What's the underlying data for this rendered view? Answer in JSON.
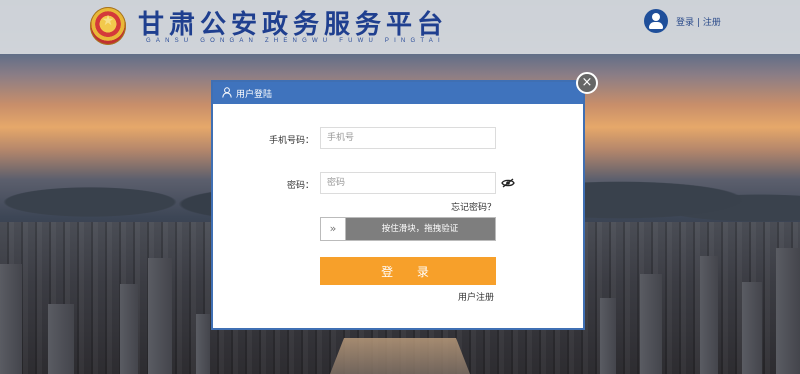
{
  "header": {
    "site_title": "甘肃公安政务服务平台",
    "site_pinyin": "GANSU GONGAN ZHENGWU FUWU PINGTAI",
    "login_link": "登录",
    "separator": "|",
    "register_link": "注册"
  },
  "dialog": {
    "title": "用户登陆",
    "phone": {
      "label": "手机号码：",
      "placeholder": "手机号",
      "value": ""
    },
    "password": {
      "label": "密码：",
      "placeholder": "密码",
      "value": ""
    },
    "forgot_password": "忘记密码？",
    "slider": {
      "handle": "»",
      "text": "按住滑块，拖拽验证"
    },
    "login_button": "登 录",
    "register_link": "用户注册",
    "close": "×"
  },
  "icons": {
    "header_user": "user-avatar-icon",
    "dialog_user": "user-outline-icon",
    "password_eye": "eye-hidden-icon",
    "close": "close-icon",
    "emblem": "police-emblem"
  },
  "colors": {
    "header_title": "#1f3f8f",
    "dialog_header": "#3f73bd",
    "login_button": "#f7a02a",
    "slider_track": "#7e7e7e"
  }
}
